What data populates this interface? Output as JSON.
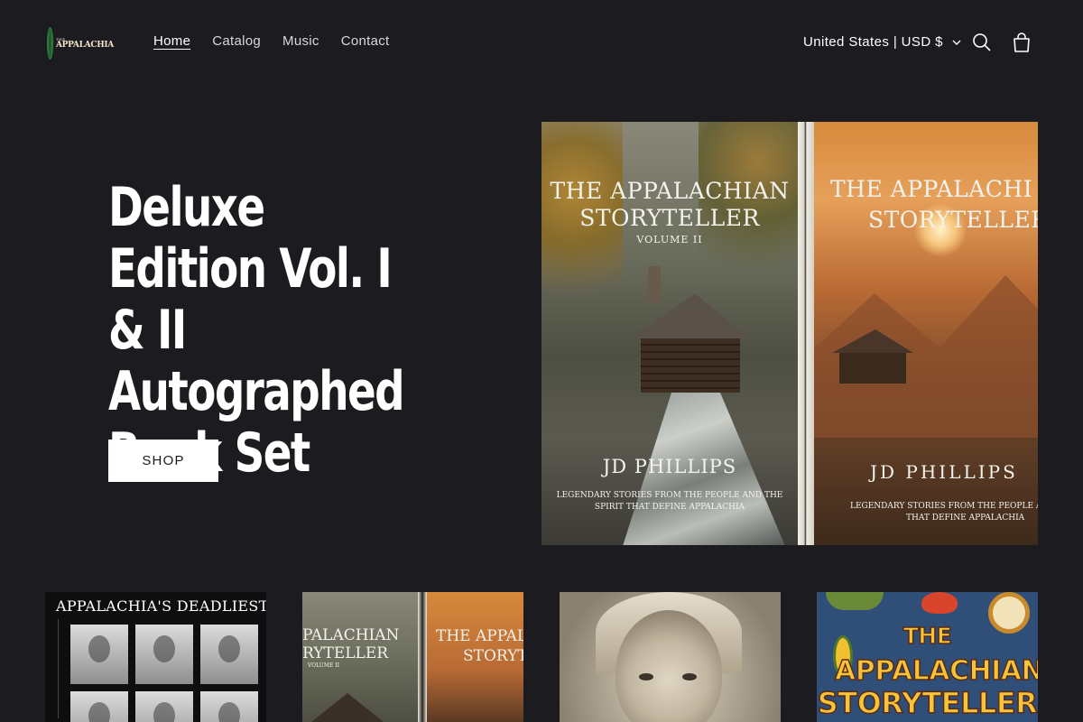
{
  "header": {
    "logo": {
      "line1": "THE",
      "line2": "APPALACHIA"
    },
    "nav": [
      {
        "label": "Home",
        "active": true
      },
      {
        "label": "Catalog",
        "active": false
      },
      {
        "label": "Music",
        "active": false
      },
      {
        "label": "Contact",
        "active": false
      }
    ],
    "currency_label": "United States | USD $",
    "icons": {
      "search": "search-icon",
      "cart": "cart-icon",
      "chevron": "chevron-down-icon"
    }
  },
  "hero": {
    "title": "Deluxe Edition Vol. I & II Autographed Book Set",
    "button_label": "SHOP",
    "image": {
      "cover1": {
        "title": "THE APPALACHIAN STORYTELLER",
        "volume": "VOLUME II",
        "author": "JD PHILLIPS",
        "tagline": "LEGENDARY STORIES FROM THE PEOPLE AND THE SPIRIT THAT DEFINE APPALACHIA"
      },
      "cover2": {
        "title_line1": "THE APPALACHI",
        "title_line2": "STORYTELLER",
        "author": "JD PHILLIPS",
        "tagline_line1": "LEGENDARY STORIES FROM THE PEOPLE AND THE S",
        "tagline_line2": "THAT DEFINE APPALACHIA"
      }
    }
  },
  "products": [
    {
      "cover_text": "APPALACHIA'S DEADLIEST"
    },
    {
      "cover_text_left_1": "PALACHIAN",
      "cover_text_left_2": "RYTELLER",
      "cover_text_left_3": "VOLUME II",
      "cover_text_right_1": "THE APPAL",
      "cover_text_right_2": "STORYT"
    },
    {
      "cover_text": ""
    },
    {
      "line1": "THE",
      "line2": "APPALACHIAN",
      "line3": "STORYTELLER"
    }
  ],
  "colors": {
    "background": "#1c1c20",
    "text": "#ffffff",
    "button_bg": "#ffffff",
    "button_text": "#1c1c20"
  }
}
